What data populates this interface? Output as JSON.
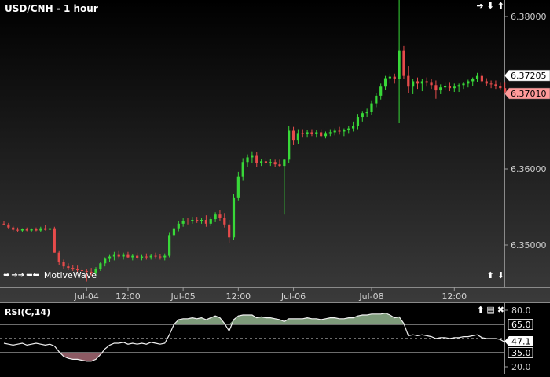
{
  "chart_title": "USD/CNH - 1 hour",
  "brand": "MotiveWave",
  "icons": {
    "top_nav": [
      "arrow-right-icon",
      "arrow-down-icon",
      "arrow-up-icon"
    ],
    "bottom_nav": [
      "arrow-up-icon",
      "arrow-down-icon"
    ],
    "rsi_nav": [
      "arrow-up-icon",
      "panel-menu-icon",
      "close-icon"
    ],
    "brand": [
      "expand-horizontal-icon",
      "scroll-right-icon",
      "scroll-left-icon"
    ]
  },
  "icon_glyphs": {
    "arrow-right-icon": "➔",
    "arrow-left-icon": "←",
    "arrow-down-icon": "⬇",
    "arrow-up-icon": "⬆",
    "panel-menu-icon": "▤",
    "close-icon": "✖",
    "expand-horizontal-icon": "⬌",
    "scroll-right-icon": "➔➔",
    "scroll-left-icon": "⬅⬅"
  },
  "colors": {
    "up": "#38d838",
    "down": "#e64b4b",
    "background": "#000000",
    "rsi_fill_high": "#7d9a7a",
    "rsi_fill_low": "#8c5a63"
  },
  "chart_data": [
    {
      "type": "candlestick",
      "title": "USD/CNH - 1 hour",
      "ylim": [
        6.3435,
        6.3825
      ],
      "y_ticks": [
        "6.38000",
        "6.36000",
        "6.35000"
      ],
      "x_ticks": [
        "Jul-04",
        "12:00",
        "Jul-05",
        "12:00",
        "Jul-06",
        "Jul-08",
        "12:00"
      ],
      "price_labels": [
        {
          "text": "6.37205",
          "value": 6.37205,
          "color": "#ffffff"
        },
        {
          "text": "6.37010",
          "value": 6.3701,
          "color": "#ff9a9a"
        }
      ],
      "candles": [
        [
          6.3528,
          6.3532,
          6.3526,
          6.3527
        ],
        [
          6.3527,
          6.3529,
          6.3521,
          6.3523
        ],
        [
          6.3523,
          6.3525,
          6.3518,
          6.352
        ],
        [
          6.352,
          6.3523,
          6.3517,
          6.3519
        ],
        [
          6.3519,
          6.3522,
          6.3517,
          6.3521
        ],
        [
          6.3521,
          6.3523,
          6.3518,
          6.3519
        ],
        [
          6.3519,
          6.3522,
          6.3517,
          6.3521
        ],
        [
          6.3521,
          6.3523,
          6.3518,
          6.3519
        ],
        [
          6.3519,
          6.3524,
          6.3517,
          6.3522
        ],
        [
          6.3522,
          6.3526,
          6.3519,
          6.352
        ],
        [
          6.352,
          6.3523,
          6.3516,
          6.3522
        ],
        [
          6.3522,
          6.3524,
          6.349,
          6.349
        ],
        [
          6.349,
          6.3493,
          6.3474,
          6.3478
        ],
        [
          6.3478,
          6.3481,
          6.3469,
          6.3472
        ],
        [
          6.3472,
          6.3476,
          6.3467,
          6.347
        ],
        [
          6.347,
          6.3474,
          6.3466,
          6.3469
        ],
        [
          6.3469,
          6.3473,
          6.3465,
          6.3467
        ],
        [
          6.3467,
          6.3471,
          6.3464,
          6.3466
        ],
        [
          6.3466,
          6.3469,
          6.3452,
          6.3465
        ],
        [
          6.3465,
          6.347,
          6.3459,
          6.3464
        ],
        [
          6.3464,
          6.3471,
          6.346,
          6.3469
        ],
        [
          6.3469,
          6.3478,
          6.3466,
          6.3476
        ],
        [
          6.3476,
          6.3484,
          6.3472,
          6.3482
        ],
        [
          6.3482,
          6.3487,
          6.3478,
          6.3485
        ],
        [
          6.3485,
          6.3491,
          6.348,
          6.3487
        ],
        [
          6.3487,
          6.3493,
          6.3482,
          6.3485
        ],
        [
          6.3485,
          6.349,
          6.3481,
          6.3487
        ],
        [
          6.3487,
          6.3491,
          6.3483,
          6.3484
        ],
        [
          6.3484,
          6.3488,
          6.348,
          6.3486
        ],
        [
          6.3486,
          6.349,
          6.3481,
          6.3483
        ],
        [
          6.3483,
          6.3487,
          6.348,
          6.3485
        ],
        [
          6.3485,
          6.3489,
          6.3481,
          6.3484
        ],
        [
          6.3484,
          6.3488,
          6.3481,
          6.3486
        ],
        [
          6.3486,
          6.349,
          6.3482,
          6.3485
        ],
        [
          6.3485,
          6.3488,
          6.3481,
          6.3484
        ],
        [
          6.3484,
          6.3489,
          6.348,
          6.3486
        ],
        [
          6.3486,
          6.3516,
          6.3484,
          6.3513
        ],
        [
          6.3513,
          6.3525,
          6.3509,
          6.3522
        ],
        [
          6.3522,
          6.3531,
          6.3518,
          6.3528
        ],
        [
          6.3528,
          6.3535,
          6.3524,
          6.3532
        ],
        [
          6.3532,
          6.3536,
          6.3527,
          6.3531
        ],
        [
          6.3531,
          6.3537,
          6.3528,
          6.3533
        ],
        [
          6.3533,
          6.3537,
          6.3529,
          6.3532
        ],
        [
          6.3532,
          6.3536,
          6.3528,
          6.3533
        ],
        [
          6.3533,
          6.3539,
          6.3524,
          6.3528
        ],
        [
          6.3528,
          6.3537,
          6.3525,
          6.3534
        ],
        [
          6.3534,
          6.3543,
          6.353,
          6.354
        ],
        [
          6.354,
          6.3546,
          6.3532,
          6.3536
        ],
        [
          6.3536,
          6.3542,
          6.3523,
          6.3527
        ],
        [
          6.3527,
          6.3533,
          6.3503,
          6.351
        ],
        [
          6.351,
          6.3567,
          6.3507,
          6.3562
        ],
        [
          6.3562,
          6.3596,
          6.3558,
          6.359
        ],
        [
          6.359,
          6.3614,
          6.3585,
          6.3609
        ],
        [
          6.3609,
          6.3619,
          6.3603,
          6.3615
        ],
        [
          6.3615,
          6.3623,
          6.3608,
          6.3618
        ],
        [
          6.3618,
          6.3622,
          6.3603,
          6.3608
        ],
        [
          6.3608,
          6.3613,
          6.3604,
          6.361
        ],
        [
          6.361,
          6.3614,
          6.3605,
          6.3608
        ],
        [
          6.3608,
          6.3613,
          6.3604,
          6.3609
        ],
        [
          6.3609,
          6.3612,
          6.3603,
          6.3606
        ],
        [
          6.3606,
          6.3612,
          6.3602,
          6.3604
        ],
        [
          6.3604,
          6.3613,
          6.354,
          6.3612
        ],
        [
          6.3612,
          6.3656,
          6.3608,
          6.365
        ],
        [
          6.365,
          6.3655,
          6.3632,
          6.3638
        ],
        [
          6.3638,
          6.3652,
          6.3633,
          6.3647
        ],
        [
          6.3647,
          6.3652,
          6.3641,
          6.3646
        ],
        [
          6.3646,
          6.3651,
          6.3641,
          6.3648
        ],
        [
          6.3648,
          6.3652,
          6.3643,
          6.3646
        ],
        [
          6.3646,
          6.3651,
          6.3641,
          6.3648
        ],
        [
          6.3648,
          6.3652,
          6.3641,
          6.3643
        ],
        [
          6.3643,
          6.3649,
          6.364,
          6.3647
        ],
        [
          6.3647,
          6.3652,
          6.3643,
          6.3648
        ],
        [
          6.3648,
          6.3653,
          6.3644,
          6.365
        ],
        [
          6.365,
          6.3655,
          6.3645,
          6.3649
        ],
        [
          6.3649,
          6.3653,
          6.3643,
          6.3651
        ],
        [
          6.3651,
          6.3656,
          6.3647,
          6.3653
        ],
        [
          6.3653,
          6.3662,
          6.3649,
          6.3656
        ],
        [
          6.3656,
          6.3672,
          6.3652,
          6.3668
        ],
        [
          6.3668,
          6.3676,
          6.3662,
          6.3673
        ],
        [
          6.3673,
          6.3679,
          6.3668,
          6.3675
        ],
        [
          6.3675,
          6.369,
          6.3671,
          6.3686
        ],
        [
          6.3686,
          6.37,
          6.3681,
          6.3696
        ],
        [
          6.3696,
          6.3712,
          6.3691,
          6.3708
        ],
        [
          6.3708,
          6.3722,
          6.3704,
          6.3719
        ],
        [
          6.3719,
          6.3725,
          6.3712,
          6.3721
        ],
        [
          6.3721,
          6.3725,
          6.3712,
          6.3718
        ],
        [
          6.3718,
          6.3826,
          6.366,
          6.3755
        ],
        [
          6.3755,
          6.3762,
          6.3718,
          6.3722
        ],
        [
          6.3722,
          6.3735,
          6.37,
          6.3708
        ],
        [
          6.3708,
          6.3718,
          6.3698,
          6.3715
        ],
        [
          6.3715,
          6.372,
          6.3705,
          6.3712
        ],
        [
          6.3712,
          6.3718,
          6.3702,
          6.3715
        ],
        [
          6.3715,
          6.372,
          6.3708,
          6.3713
        ],
        [
          6.3713,
          6.3718,
          6.3705,
          6.371
        ],
        [
          6.371,
          6.3716,
          6.3692,
          6.3703
        ],
        [
          6.3703,
          6.3711,
          6.3698,
          6.3707
        ],
        [
          6.3707,
          6.3713,
          6.3703,
          6.3709
        ],
        [
          6.3709,
          6.3713,
          6.3702,
          6.3706
        ],
        [
          6.3706,
          6.3712,
          6.3701,
          6.3708
        ],
        [
          6.3708,
          6.3712,
          6.3701,
          6.371
        ],
        [
          6.371,
          6.3714,
          6.3705,
          6.3712
        ],
        [
          6.3712,
          6.3717,
          6.3707,
          6.3715
        ],
        [
          6.3715,
          6.372,
          6.3709,
          6.3718
        ],
        [
          6.3718,
          6.3726,
          6.3714,
          6.3722
        ],
        [
          6.3722,
          6.3726,
          6.3712,
          6.3715
        ],
        [
          6.3715,
          6.3719,
          6.3709,
          6.3712
        ],
        [
          6.3712,
          6.3716,
          6.3706,
          6.3711
        ],
        [
          6.3711,
          6.3716,
          6.3705,
          6.3709
        ],
        [
          6.3709,
          6.3713,
          6.3703,
          6.3706
        ],
        [
          6.3706,
          6.3713,
          6.37,
          6.3701
        ]
      ]
    },
    {
      "type": "line",
      "title": "RSI(C,14)",
      "ylim": [
        18,
        86
      ],
      "levels": [
        65.0,
        35.0
      ],
      "y_ticks": [
        "80.0",
        "65.0",
        "47.1",
        "35.0",
        "20.0"
      ],
      "current": "47.1",
      "values": [
        45,
        44,
        43,
        44,
        45,
        43,
        44,
        45,
        44,
        43,
        44,
        42,
        36,
        31,
        29,
        28,
        28,
        27,
        26,
        26,
        28,
        33,
        39,
        43,
        45,
        45,
        46,
        44,
        45,
        44,
        45,
        44,
        46,
        45,
        44,
        45,
        54,
        65,
        70,
        71,
        71,
        72,
        71,
        72,
        70,
        72,
        74,
        72,
        66,
        58,
        70,
        74,
        75,
        75,
        75,
        72,
        73,
        72,
        72,
        71,
        70,
        68,
        71,
        71,
        71,
        71,
        72,
        71,
        71,
        70,
        71,
        72,
        72,
        71,
        71,
        72,
        72,
        74,
        75,
        75,
        76,
        76,
        76,
        77,
        75,
        72,
        73,
        66,
        53,
        54,
        53,
        54,
        53,
        52,
        50,
        51,
        51,
        50,
        51,
        51,
        52,
        52,
        53,
        54,
        51,
        50,
        50,
        50,
        49,
        46
      ]
    }
  ]
}
